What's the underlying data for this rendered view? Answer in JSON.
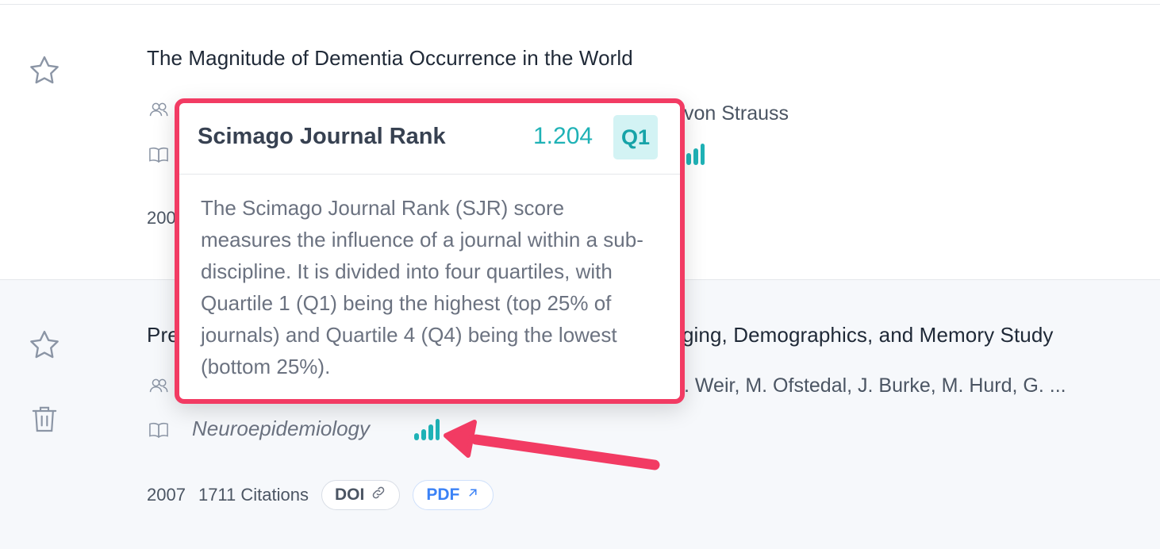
{
  "papers": [
    {
      "title": "The Magnitude of Dementia Occurrence in the World",
      "authors_visible": "von Strauss",
      "year": "200"
    },
    {
      "title_left": "Pre",
      "title_right": "ging, Demographics, and Memory Study",
      "authors_visible": ". Weir, M. Ofstedal, J. Burke, M. Hurd, G. ...",
      "journal": "Neuroepidemiology",
      "year": "2007",
      "citations": "1711 Citations",
      "doi_label": "DOI",
      "pdf_label": "PDF"
    }
  ],
  "tooltip": {
    "title": "Scimago Journal Rank",
    "score": "1.204",
    "quartile": "Q1",
    "body": "The Scimago Journal Rank (SJR) score measures the influence of a journal within a sub-discipline. It is divided into four quartiles, with Quartile 1 (Q1) being the highest (top 25% of journals) and Quartile 4 (Q4) being the lowest (bottom 25%)."
  },
  "colors": {
    "highlight": "#f23b63",
    "sjr_accent": "#1fb2b6",
    "pdf_link": "#3b82f6"
  },
  "icons": [
    "star-icon",
    "trash-icon",
    "authors-icon",
    "book-icon",
    "sjr-bars-icon",
    "link-icon",
    "external-arrow-icon"
  ]
}
